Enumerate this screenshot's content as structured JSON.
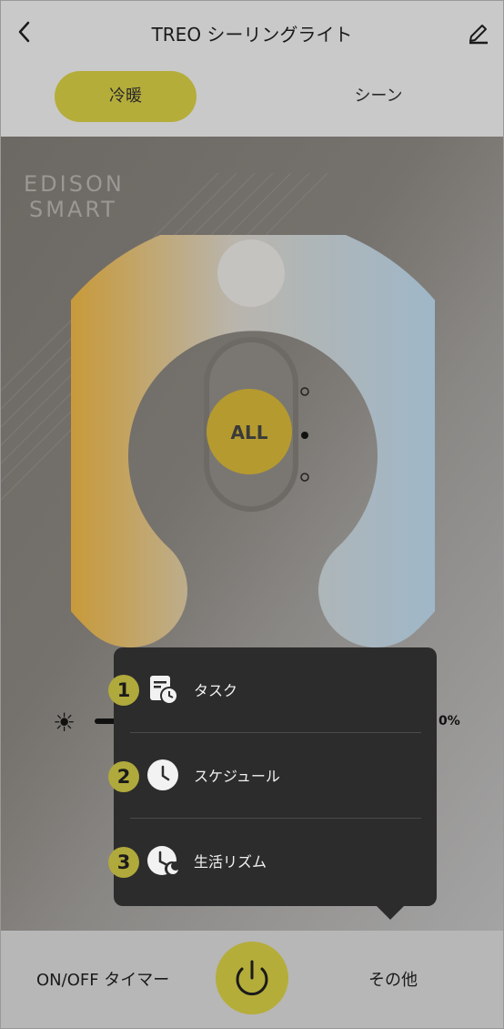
{
  "header": {
    "title": "TREO シーリングライト",
    "back_icon": "chevron-left-icon",
    "edit_icon": "pencil-icon"
  },
  "tabs": [
    {
      "label": "冷暖",
      "active": true
    },
    {
      "label": "シーン",
      "active": false
    }
  ],
  "logo": {
    "line1": "EDISON",
    "line2": "SMART"
  },
  "dial": {
    "center_label": "ALL",
    "warm_color": "#c89a3a",
    "cool_color": "#9fb7c8",
    "knob_color": "#b59a2f"
  },
  "brightness": {
    "icon": "sun-icon",
    "value_suffix": "0%"
  },
  "popup_menu": {
    "items": [
      {
        "number": "1",
        "icon": "task-clock-icon",
        "label": "タスク"
      },
      {
        "number": "2",
        "icon": "clock-icon",
        "label": "スケジュール"
      },
      {
        "number": "3",
        "icon": "life-rhythm-moon-icon",
        "label": "生活リズム"
      }
    ]
  },
  "footer": {
    "timer_label": "ON/OFF タイマー",
    "power_icon": "power-icon",
    "other_label": "その他"
  },
  "colors": {
    "accent": "#b5ad3a",
    "popup_bg": "#2c2c2c"
  }
}
